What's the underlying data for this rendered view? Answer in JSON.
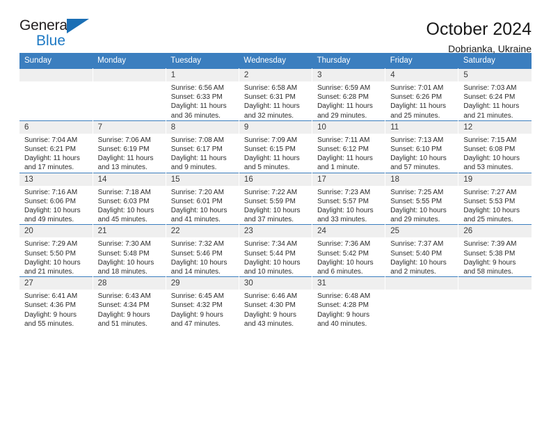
{
  "brand": {
    "name_top": "General",
    "name_bottom": "Blue",
    "accent_color": "#1b6fb5"
  },
  "header": {
    "title": "October 2024",
    "subtitle": "Dobrianka, Ukraine"
  },
  "calendar": {
    "header_bg": "#3b7ebf",
    "daynum_bg": "#efefef",
    "weekday_headers": [
      "Sunday",
      "Monday",
      "Tuesday",
      "Wednesday",
      "Thursday",
      "Friday",
      "Saturday"
    ],
    "weeks": [
      [
        {
          "day": ""
        },
        {
          "day": ""
        },
        {
          "day": "1",
          "sunrise": "Sunrise: 6:56 AM",
          "sunset": "Sunset: 6:33 PM",
          "daylight": "Daylight: 11 hours and 36 minutes."
        },
        {
          "day": "2",
          "sunrise": "Sunrise: 6:58 AM",
          "sunset": "Sunset: 6:31 PM",
          "daylight": "Daylight: 11 hours and 32 minutes."
        },
        {
          "day": "3",
          "sunrise": "Sunrise: 6:59 AM",
          "sunset": "Sunset: 6:28 PM",
          "daylight": "Daylight: 11 hours and 29 minutes."
        },
        {
          "day": "4",
          "sunrise": "Sunrise: 7:01 AM",
          "sunset": "Sunset: 6:26 PM",
          "daylight": "Daylight: 11 hours and 25 minutes."
        },
        {
          "day": "5",
          "sunrise": "Sunrise: 7:03 AM",
          "sunset": "Sunset: 6:24 PM",
          "daylight": "Daylight: 11 hours and 21 minutes."
        }
      ],
      [
        {
          "day": "6",
          "sunrise": "Sunrise: 7:04 AM",
          "sunset": "Sunset: 6:21 PM",
          "daylight": "Daylight: 11 hours and 17 minutes."
        },
        {
          "day": "7",
          "sunrise": "Sunrise: 7:06 AM",
          "sunset": "Sunset: 6:19 PM",
          "daylight": "Daylight: 11 hours and 13 minutes."
        },
        {
          "day": "8",
          "sunrise": "Sunrise: 7:08 AM",
          "sunset": "Sunset: 6:17 PM",
          "daylight": "Daylight: 11 hours and 9 minutes."
        },
        {
          "day": "9",
          "sunrise": "Sunrise: 7:09 AM",
          "sunset": "Sunset: 6:15 PM",
          "daylight": "Daylight: 11 hours and 5 minutes."
        },
        {
          "day": "10",
          "sunrise": "Sunrise: 7:11 AM",
          "sunset": "Sunset: 6:12 PM",
          "daylight": "Daylight: 11 hours and 1 minute."
        },
        {
          "day": "11",
          "sunrise": "Sunrise: 7:13 AM",
          "sunset": "Sunset: 6:10 PM",
          "daylight": "Daylight: 10 hours and 57 minutes."
        },
        {
          "day": "12",
          "sunrise": "Sunrise: 7:15 AM",
          "sunset": "Sunset: 6:08 PM",
          "daylight": "Daylight: 10 hours and 53 minutes."
        }
      ],
      [
        {
          "day": "13",
          "sunrise": "Sunrise: 7:16 AM",
          "sunset": "Sunset: 6:06 PM",
          "daylight": "Daylight: 10 hours and 49 minutes."
        },
        {
          "day": "14",
          "sunrise": "Sunrise: 7:18 AM",
          "sunset": "Sunset: 6:03 PM",
          "daylight": "Daylight: 10 hours and 45 minutes."
        },
        {
          "day": "15",
          "sunrise": "Sunrise: 7:20 AM",
          "sunset": "Sunset: 6:01 PM",
          "daylight": "Daylight: 10 hours and 41 minutes."
        },
        {
          "day": "16",
          "sunrise": "Sunrise: 7:22 AM",
          "sunset": "Sunset: 5:59 PM",
          "daylight": "Daylight: 10 hours and 37 minutes."
        },
        {
          "day": "17",
          "sunrise": "Sunrise: 7:23 AM",
          "sunset": "Sunset: 5:57 PM",
          "daylight": "Daylight: 10 hours and 33 minutes."
        },
        {
          "day": "18",
          "sunrise": "Sunrise: 7:25 AM",
          "sunset": "Sunset: 5:55 PM",
          "daylight": "Daylight: 10 hours and 29 minutes."
        },
        {
          "day": "19",
          "sunrise": "Sunrise: 7:27 AM",
          "sunset": "Sunset: 5:53 PM",
          "daylight": "Daylight: 10 hours and 25 minutes."
        }
      ],
      [
        {
          "day": "20",
          "sunrise": "Sunrise: 7:29 AM",
          "sunset": "Sunset: 5:50 PM",
          "daylight": "Daylight: 10 hours and 21 minutes."
        },
        {
          "day": "21",
          "sunrise": "Sunrise: 7:30 AM",
          "sunset": "Sunset: 5:48 PM",
          "daylight": "Daylight: 10 hours and 18 minutes."
        },
        {
          "day": "22",
          "sunrise": "Sunrise: 7:32 AM",
          "sunset": "Sunset: 5:46 PM",
          "daylight": "Daylight: 10 hours and 14 minutes."
        },
        {
          "day": "23",
          "sunrise": "Sunrise: 7:34 AM",
          "sunset": "Sunset: 5:44 PM",
          "daylight": "Daylight: 10 hours and 10 minutes."
        },
        {
          "day": "24",
          "sunrise": "Sunrise: 7:36 AM",
          "sunset": "Sunset: 5:42 PM",
          "daylight": "Daylight: 10 hours and 6 minutes."
        },
        {
          "day": "25",
          "sunrise": "Sunrise: 7:37 AM",
          "sunset": "Sunset: 5:40 PM",
          "daylight": "Daylight: 10 hours and 2 minutes."
        },
        {
          "day": "26",
          "sunrise": "Sunrise: 7:39 AM",
          "sunset": "Sunset: 5:38 PM",
          "daylight": "Daylight: 9 hours and 58 minutes."
        }
      ],
      [
        {
          "day": "27",
          "sunrise": "Sunrise: 6:41 AM",
          "sunset": "Sunset: 4:36 PM",
          "daylight": "Daylight: 9 hours and 55 minutes."
        },
        {
          "day": "28",
          "sunrise": "Sunrise: 6:43 AM",
          "sunset": "Sunset: 4:34 PM",
          "daylight": "Daylight: 9 hours and 51 minutes."
        },
        {
          "day": "29",
          "sunrise": "Sunrise: 6:45 AM",
          "sunset": "Sunset: 4:32 PM",
          "daylight": "Daylight: 9 hours and 47 minutes."
        },
        {
          "day": "30",
          "sunrise": "Sunrise: 6:46 AM",
          "sunset": "Sunset: 4:30 PM",
          "daylight": "Daylight: 9 hours and 43 minutes."
        },
        {
          "day": "31",
          "sunrise": "Sunrise: 6:48 AM",
          "sunset": "Sunset: 4:28 PM",
          "daylight": "Daylight: 9 hours and 40 minutes."
        },
        {
          "day": ""
        },
        {
          "day": ""
        }
      ]
    ]
  }
}
